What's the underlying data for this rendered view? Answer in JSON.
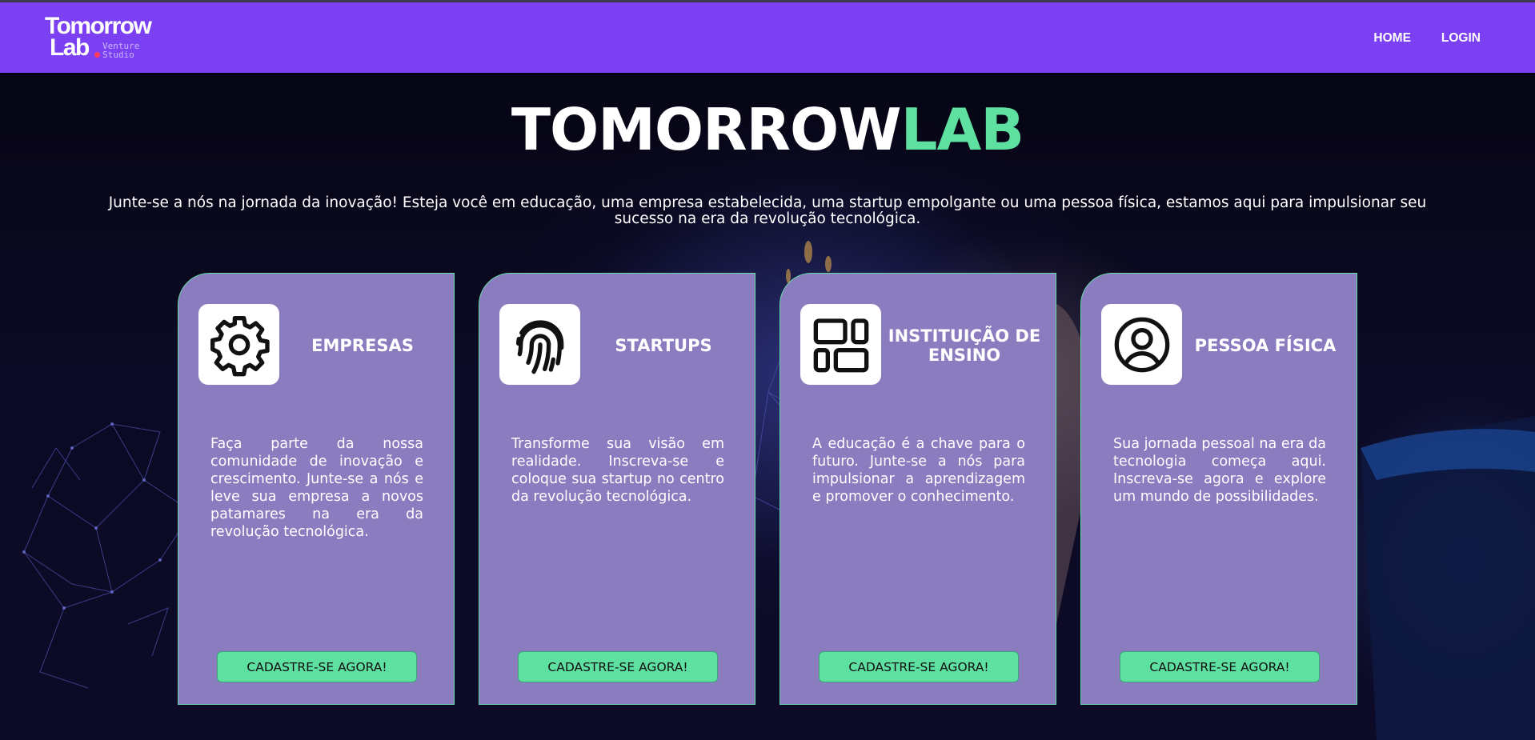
{
  "header": {
    "logo": {
      "line1": "Tomorrow",
      "line2": "Lab",
      "sub1": "Venture",
      "sub2": "Studio"
    },
    "nav": [
      {
        "label": "HOME"
      },
      {
        "label": "LOGIN"
      }
    ]
  },
  "hero": {
    "title_part1": "TOMORROW",
    "title_part2": "LAB",
    "text": "Junte-se a nós na jornada da inovação! Esteja você em educação, uma empresa estabelecida, uma startup empolgante ou uma pessoa física, estamos aqui para impulsionar seu sucesso na era da revolução tecnológica."
  },
  "cards": [
    {
      "title": "EMPRESAS",
      "icon": "gear-icon",
      "text": "Faça parte da nossa comunidade de inovação e crescimento. Junte-se a nós e leve sua empresa a novos patamares na era da revolução tecnológica.",
      "button": "CADASTRE-SE AGORA!"
    },
    {
      "title": "STARTUPS",
      "icon": "fingerprint-icon",
      "text": "Transforme sua visão em realidade. Inscreva-se e coloque sua startup no centro da revolução tecnológica.",
      "button": "CADASTRE-SE AGORA!"
    },
    {
      "title": "INSTITUIÇÃO DE ENSINO",
      "icon": "layout-icon",
      "text": "A educação é a chave para o futuro. Junte-se a nós para impulsionar a aprendizagem e promover o conhecimento.",
      "button": "CADASTRE-SE AGORA!"
    },
    {
      "title": "PESSOA FÍSICA",
      "icon": "user-circle-icon",
      "text": "Sua jornada pessoal na era da tecnologia começa aqui. Inscreva-se agora e explore um mundo de possibilidades.",
      "button": "CADASTRE-SE AGORA!"
    }
  ],
  "colors": {
    "header": "#7b40f2",
    "card": "#8b7bbf",
    "accent": "#5ee0a0"
  }
}
